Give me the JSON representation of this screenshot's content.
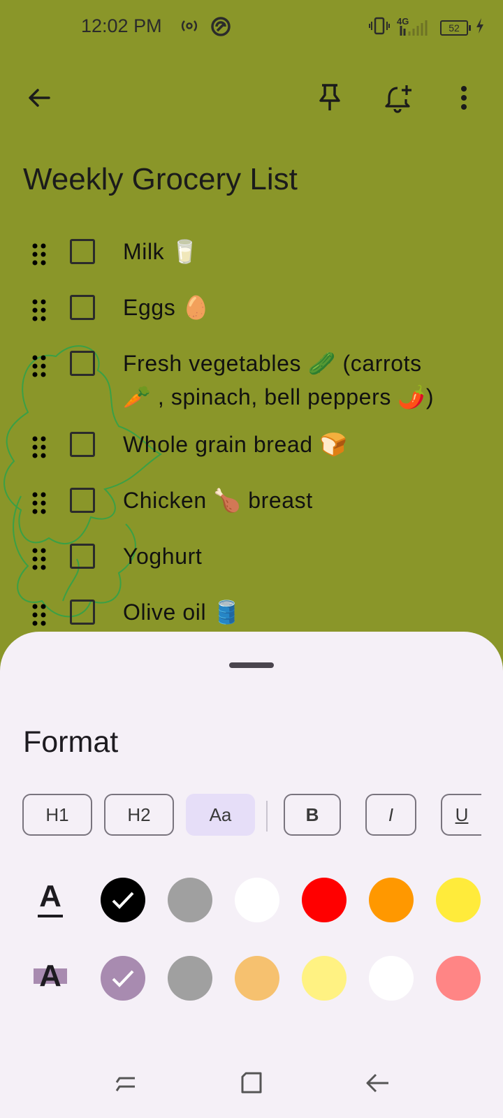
{
  "status_bar": {
    "time": "12:02 PM",
    "network": "4G",
    "battery": "52",
    "icons": [
      "hotspot-icon",
      "sync-icon",
      "vibrate-icon",
      "signal-icon",
      "battery-icon",
      "charging-icon"
    ]
  },
  "toolbar": {
    "icons": [
      "back-arrow-icon",
      "pin-icon",
      "add-reminder-icon",
      "more-vert-icon"
    ]
  },
  "note": {
    "background_color": "#8a9629",
    "title": "Weekly Grocery List",
    "items": [
      {
        "label": "Milk 🥛",
        "checked": false
      },
      {
        "label": "Eggs 🥚",
        "checked": false
      },
      {
        "label": "Fresh vegetables 🥒 (carrots 🥕 ,  spinach, bell peppers 🌶️)",
        "checked": false
      },
      {
        "label": "Whole grain bread 🍞",
        "checked": false
      },
      {
        "label": "Chicken 🍗 breast",
        "checked": false
      },
      {
        "label": "Yoghurt",
        "checked": false
      },
      {
        "label": "Olive oil 🛢️",
        "checked": false
      }
    ]
  },
  "format_sheet": {
    "title": "Format",
    "buttons": [
      {
        "label": "H1",
        "selected": false
      },
      {
        "label": "H2",
        "selected": false
      },
      {
        "label": "Aa",
        "selected": true
      },
      {
        "label": "B",
        "selected": false
      },
      {
        "label": "I",
        "selected": false
      },
      {
        "label": "U",
        "selected": false
      }
    ],
    "text_color_label": "A",
    "text_colors": [
      {
        "color": "#000000",
        "selected": true
      },
      {
        "color": "#a0a0a0",
        "selected": false
      },
      {
        "color": "#ffffff",
        "selected": false
      },
      {
        "color": "#ff0000",
        "selected": false
      },
      {
        "color": "#ff9800",
        "selected": false
      },
      {
        "color": "#ffeb3b",
        "selected": false
      }
    ],
    "highlight_label": "A",
    "highlight_colors": [
      {
        "color": "#a88bb0",
        "selected": true
      },
      {
        "color": "#a0a0a0",
        "selected": false
      },
      {
        "color": "#f6c16f",
        "selected": false
      },
      {
        "color": "#fff282",
        "selected": false
      },
      {
        "color": "#ffffff",
        "selected": false
      },
      {
        "color": "#ff8585",
        "selected": false
      }
    ]
  },
  "nav_bar": {
    "icons": [
      "recent-apps-icon",
      "home-icon",
      "nav-back-icon"
    ]
  }
}
